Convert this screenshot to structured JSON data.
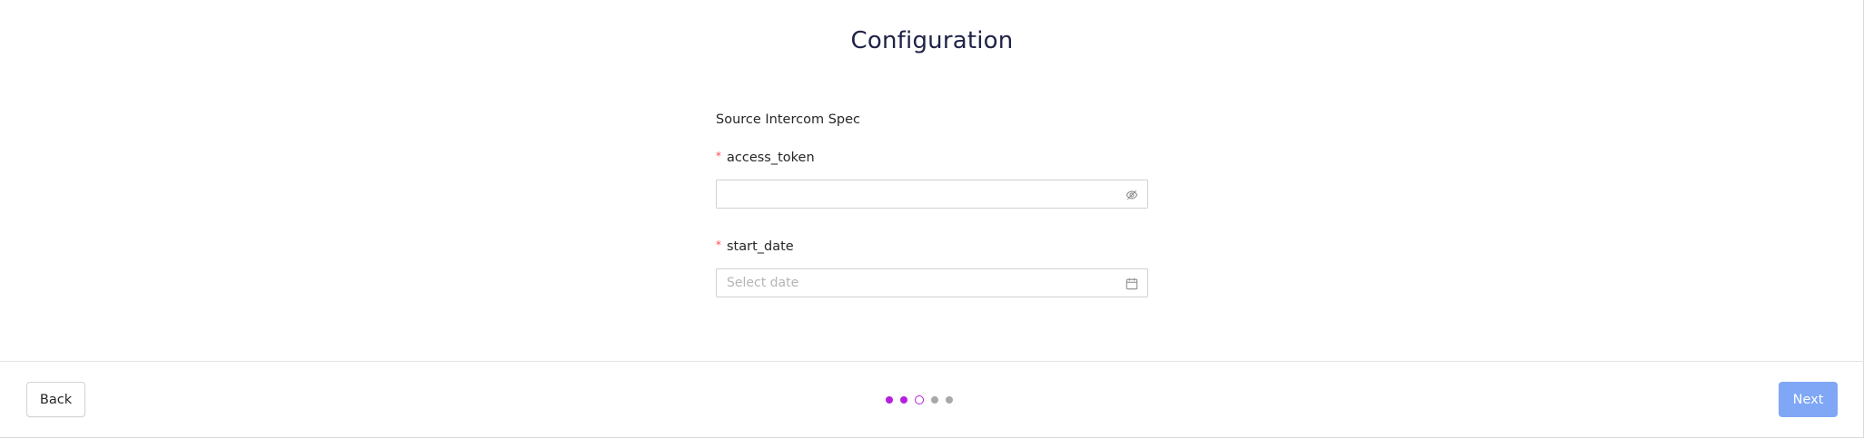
{
  "header": {
    "title": "Configuration"
  },
  "form": {
    "section_title": "Source Intercom Spec",
    "fields": [
      {
        "required_marker": "*",
        "label": "access_token",
        "value": "",
        "placeholder": "",
        "icon": "eye-invisible-icon"
      },
      {
        "required_marker": "*",
        "label": "start_date",
        "value": "",
        "placeholder": "Select date",
        "icon": "calendar-icon"
      }
    ]
  },
  "footer": {
    "back_label": "Back",
    "next_label": "Next",
    "steps": {
      "total": 5,
      "current": 3
    }
  },
  "colors": {
    "accent": "#b61fe0",
    "next_button": "#7fa7f6",
    "required": "#ff4d4f",
    "inactive_step": "#a8a8a8"
  }
}
